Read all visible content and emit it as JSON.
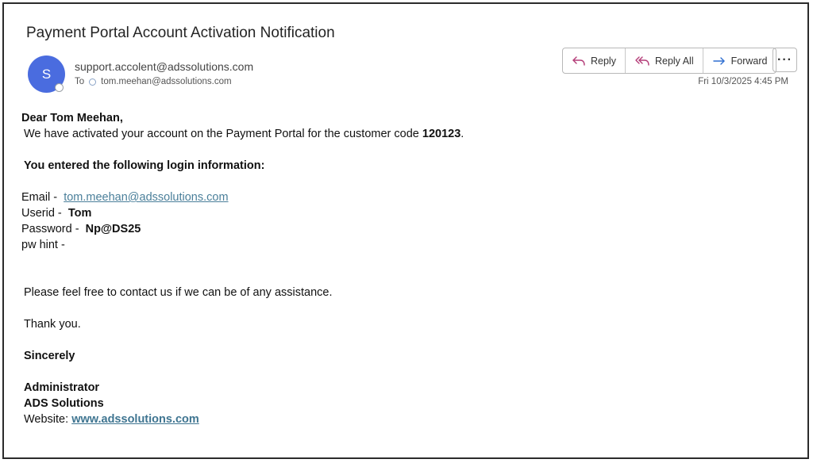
{
  "email": {
    "subject": "Payment Portal Account Activation Notification",
    "avatar_initial": "S",
    "sender": "support.accolent@adssolutions.com",
    "to_label": "To",
    "to_address": "tom.meehan@adssolutions.com",
    "timestamp": "Fri 10/3/2025 4:45 PM"
  },
  "actions": {
    "reply": "Reply",
    "reply_all": "Reply All",
    "forward": "Forward",
    "more": "···"
  },
  "body": {
    "greeting": "Dear Tom Meehan,",
    "activation_text": "We have activated your account on the Payment Portal for the customer code",
    "customer_code": "120123",
    "login_heading": "You entered the following login information:",
    "email_label": "Email -",
    "email_value": "tom.meehan@adssolutions.com",
    "userid_label": "Userid -",
    "userid_value": "Tom",
    "password_label": "Password -",
    "password_value": "Np@DS25",
    "pwhint_label": "pw hint -",
    "contact_text": "Please feel free to contact us if we can be of any assistance.",
    "thanks": "Thank you.",
    "closing": "Sincerely",
    "signature_title": "Administrator",
    "signature_company": "ADS Solutions",
    "website_label": "Website:",
    "website_value": "www.adssolutions.com"
  },
  "colors": {
    "avatar": "#4a6cdf",
    "link": "#4a7f9a",
    "reply_icon": "#b43d78",
    "forward_icon": "#2f6fd1"
  }
}
